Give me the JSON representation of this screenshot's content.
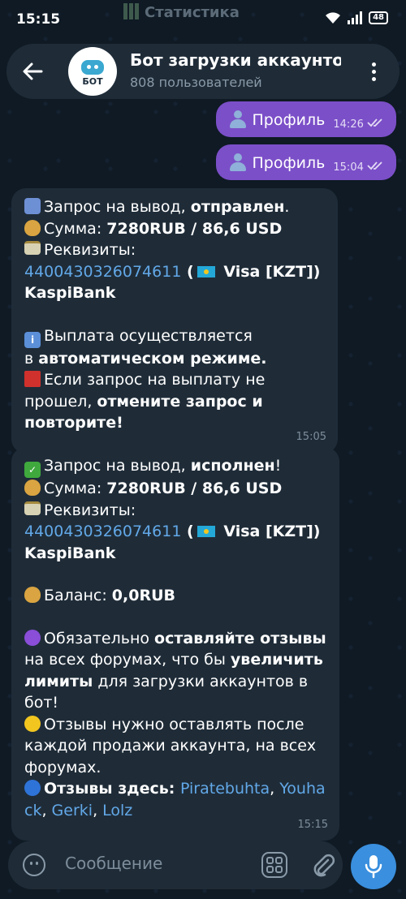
{
  "status": {
    "time": "15:15",
    "battery": "48",
    "pinned_ghost": "Статистика"
  },
  "header": {
    "title": "Бот загрузки аккаунто",
    "subtitle": "808 пользователей",
    "avatar_text": "БОТ"
  },
  "outgoing": [
    {
      "text": "Профиль",
      "time": "14:26"
    },
    {
      "text": "Профиль",
      "time": "15:04"
    }
  ],
  "msg1": {
    "l1a": "Запрос на вывод, ",
    "l1b": "отправлен",
    "l1c": ".",
    "l2a": "Сумма: ",
    "l2b": "7280RUB  / 86,6 USD",
    "l3": "Реквизиты:",
    "card": "4400430326074611",
    "l4b": " Visa [KZT])",
    "l4open": " (",
    "bank": "KaspiBank",
    "i1": "Выплата осуществляется",
    "i2a": "в ",
    "i2b": "автоматическом режиме.",
    "r1": "Если запрос на выплату не",
    "r2a": "прошел, ",
    "r2b": "отмените запрос и",
    "r3": "повторите!",
    "time": "15:05"
  },
  "msg2": {
    "l1a": "Запрос на вывод, ",
    "l1b": "исполнен",
    "l1c": "!",
    "l2a": "Сумма: ",
    "l2b": "7280RUB  / 86,6 USD",
    "l3": "Реквизиты:",
    "card": "4400430326074611",
    "l4open": " (",
    "l4b": " Visa [KZT])",
    "bank": "KaspiBank",
    "bal_a": "Баланс: ",
    "bal_b": "0,0RUB",
    "p1a": "Обязательно ",
    "p1b": "оставляйте отзывы",
    "p2a": "на всех форумах, что бы ",
    "p2b": "увеличить",
    "p3a": "лимиты",
    "p3b": " для загрузки аккаунтов в",
    "p4": "бот!",
    "y1": "Отзывы нужно оставлять после",
    "y2": "каждой продажи аккаунта, на всех",
    "y3": "форумах.",
    "b1": "Отзывы здесь: ",
    "link1": "Piratebuhta",
    "sep1": ", ",
    "link2a": "Youha",
    "link2b": "ck",
    "sep2": ", ",
    "link3": "Gerki",
    "sep3": ", ",
    "link4": "Lolz",
    "time": "15:15"
  },
  "composer": {
    "placeholder": "Сообщение"
  }
}
